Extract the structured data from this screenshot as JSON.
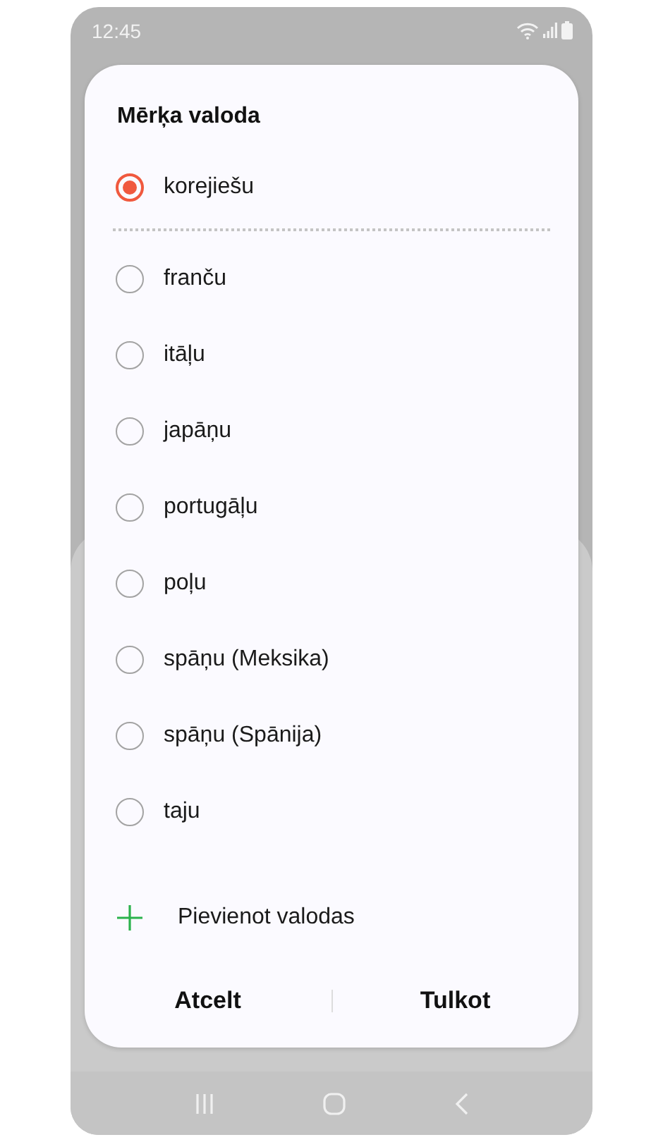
{
  "status_bar": {
    "time": "12:45"
  },
  "dialog": {
    "title": "Mērķa valoda",
    "current": {
      "label": "korejiešu",
      "selected": true
    },
    "options": [
      {
        "label": "franču",
        "selected": false
      },
      {
        "label": "itāļu",
        "selected": false
      },
      {
        "label": "japāņu",
        "selected": false
      },
      {
        "label": "portugāļu",
        "selected": false
      },
      {
        "label": "poļu",
        "selected": false
      },
      {
        "label": "spāņu (Meksika)",
        "selected": false
      },
      {
        "label": "spāņu (Spānija)",
        "selected": false
      },
      {
        "label": "taju",
        "selected": false
      }
    ],
    "add_action": "Pievienot valodas",
    "buttons": [
      "Atcelt",
      "Tulkot"
    ]
  }
}
